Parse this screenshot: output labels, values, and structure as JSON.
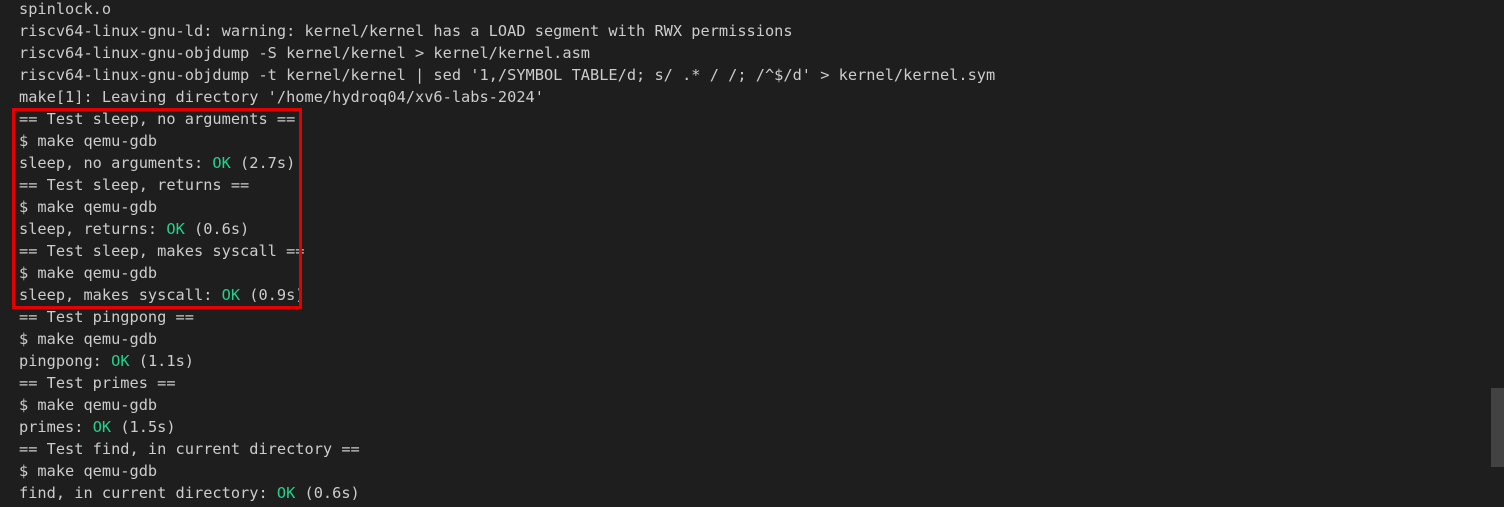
{
  "terminal": {
    "lines": [
      {
        "text": "spinlock.o"
      },
      {
        "text": "riscv64-linux-gnu-ld: warning: kernel/kernel has a LOAD segment with RWX permissions"
      },
      {
        "text": "riscv64-linux-gnu-objdump -S kernel/kernel > kernel/kernel.asm"
      },
      {
        "text": "riscv64-linux-gnu-objdump -t kernel/kernel | sed '1,/SYMBOL TABLE/d; s/ .* / /; /^$/d' > kernel/kernel.sym"
      },
      {
        "text": "make[1]: Leaving directory '/home/hydroq04/xv6-labs-2024'"
      },
      {
        "text": "== Test sleep, no arguments =="
      },
      {
        "text": "$ make qemu-gdb"
      },
      {
        "text": "sleep, no arguments: ",
        "ok": "OK",
        "time": " (2.7s)"
      },
      {
        "text": "== Test sleep, returns =="
      },
      {
        "text": "$ make qemu-gdb"
      },
      {
        "text": "sleep, returns: ",
        "ok": "OK",
        "time": " (0.6s)"
      },
      {
        "text": "== Test sleep, makes syscall =="
      },
      {
        "text": "$ make qemu-gdb"
      },
      {
        "text": "sleep, makes syscall: ",
        "ok": "OK",
        "time": " (0.9s)"
      },
      {
        "text": "== Test pingpong =="
      },
      {
        "text": "$ make qemu-gdb"
      },
      {
        "text": "pingpong: ",
        "ok": "OK",
        "time": " (1.1s)"
      },
      {
        "text": "== Test primes =="
      },
      {
        "text": "$ make qemu-gdb"
      },
      {
        "text": "primes: ",
        "ok": "OK",
        "time": " (1.5s)"
      },
      {
        "text": "== Test find, in current directory =="
      },
      {
        "text": "$ make qemu-gdb"
      },
      {
        "text": "find, in current directory: ",
        "ok": "OK",
        "time": " (0.6s)"
      }
    ]
  },
  "colors": {
    "background": "#1e1e1e",
    "text": "#cccccc",
    "ok": "#23d18b",
    "highlight_border": "#e50000"
  }
}
